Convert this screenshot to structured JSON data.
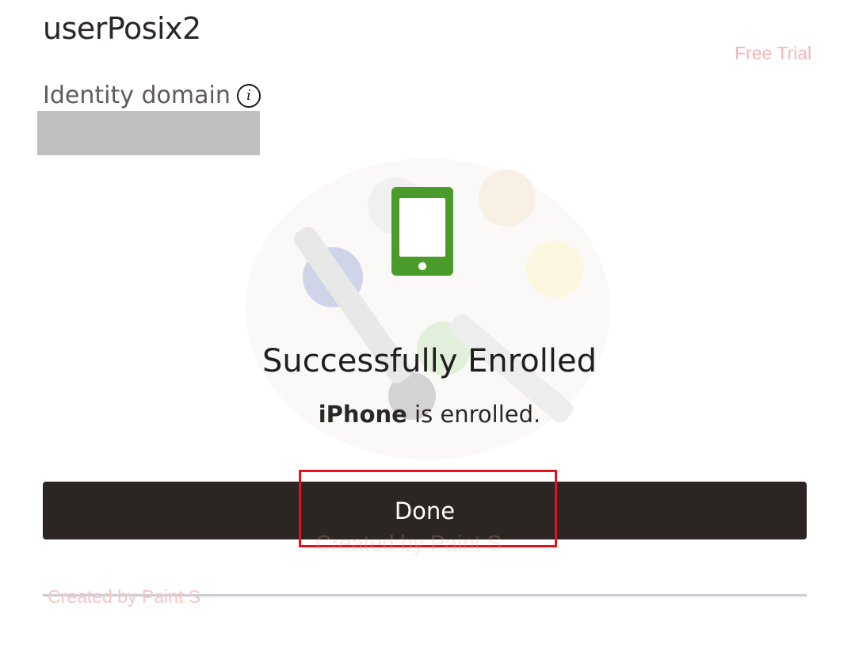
{
  "header": {
    "username": "userPosix2",
    "trial_watermark": "Free Trial"
  },
  "identity_domain": {
    "label": "Identity domain",
    "info_icon": "info-icon",
    "value_redacted": true
  },
  "enrollment": {
    "device_icon": "tablet-icon",
    "device_icon_color": "#4a9c2a",
    "title": "Successfully Enrolled",
    "device_name": "iPhone",
    "message_suffix": "is enrolled."
  },
  "actions": {
    "done_label": "Done",
    "highlight_color": "#e0121e"
  },
  "watermarks": {
    "center_text": "Created by Paint S",
    "bottom_text": "Created by Paint S"
  }
}
